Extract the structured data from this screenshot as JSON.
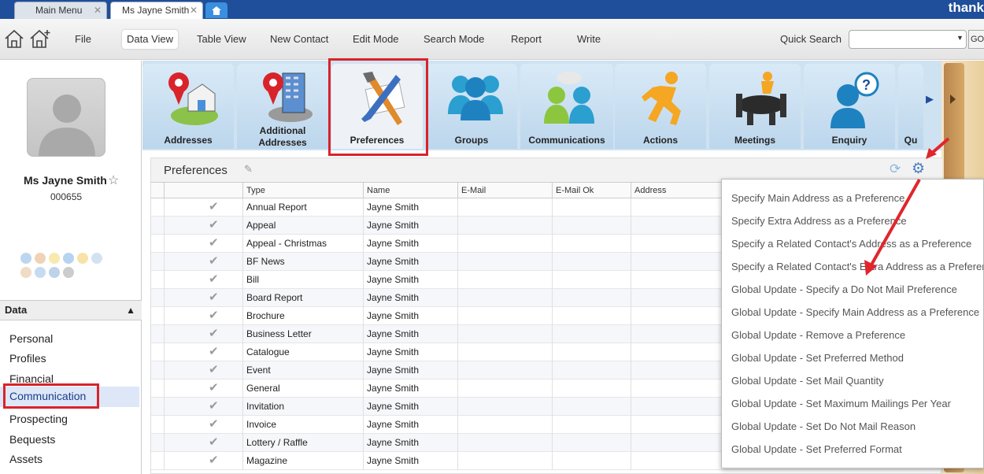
{
  "tabs": [
    {
      "label": "Main Menu"
    },
    {
      "label": "Ms Jayne Smith"
    }
  ],
  "brand": "thank",
  "menu": {
    "items": [
      "File",
      "Data View",
      "Table View",
      "New Contact",
      "Edit Mode",
      "Search Mode",
      "Report",
      "Write"
    ],
    "quick_search_label": "Quick Search",
    "go_label": "GO"
  },
  "contact": {
    "name": "Ms Jayne Smith",
    "id": "000655"
  },
  "left_nav": {
    "header": "Data",
    "items": [
      "Personal",
      "Profiles",
      "Financial",
      "Communication",
      "Prospecting",
      "Bequests",
      "Assets"
    ]
  },
  "modules": [
    {
      "label": "Addresses",
      "icon": "pin-house-icon"
    },
    {
      "label": "Additional Addresses",
      "icon": "pin-building-icon"
    },
    {
      "label": "Preferences",
      "icon": "tools-icon"
    },
    {
      "label": "Groups",
      "icon": "people-icon"
    },
    {
      "label": "Communications",
      "icon": "people-chat-icon"
    },
    {
      "label": "Actions",
      "icon": "running-man-icon"
    },
    {
      "label": "Meetings",
      "icon": "meeting-table-icon"
    },
    {
      "label": "Enquiry",
      "icon": "question-person-icon"
    },
    {
      "label": "Qu",
      "icon": "partial-icon"
    }
  ],
  "grid": {
    "title": "Preferences",
    "columns": [
      "Type",
      "Name",
      "E-Mail",
      "E-Mail Ok",
      "Address"
    ],
    "rows": [
      {
        "type": "Annual Report",
        "name": "Jayne Smith"
      },
      {
        "type": "Appeal",
        "name": "Jayne Smith"
      },
      {
        "type": "Appeal - Christmas",
        "name": "Jayne Smith"
      },
      {
        "type": "BF News",
        "name": "Jayne Smith"
      },
      {
        "type": "Bill",
        "name": "Jayne Smith"
      },
      {
        "type": "Board Report",
        "name": "Jayne Smith"
      },
      {
        "type": "Brochure",
        "name": "Jayne Smith"
      },
      {
        "type": "Business Letter",
        "name": "Jayne Smith"
      },
      {
        "type": "Catalogue",
        "name": "Jayne Smith"
      },
      {
        "type": "Event",
        "name": "Jayne Smith"
      },
      {
        "type": "General",
        "name": "Jayne Smith"
      },
      {
        "type": "Invitation",
        "name": "Jayne Smith"
      },
      {
        "type": "Invoice",
        "name": "Jayne Smith"
      },
      {
        "type": "Lottery / Raffle",
        "name": "Jayne Smith"
      },
      {
        "type": "Magazine",
        "name": "Jayne Smith"
      }
    ]
  },
  "dropdown": {
    "items": [
      "Specify Main Address as a Preference",
      "Specify Extra Address as a Preference",
      "Specify a Related Contact's Address as a Preference",
      "Specify a Related Contact's Extra Address as a Preference",
      "Global Update - Specify a Do Not Mail Preference",
      "Global Update - Specify Main Address as a Preference",
      "Global Update - Remove a Preference",
      "Global Update - Set Preferred Method",
      "Global Update - Set Mail Quantity",
      "Global Update - Set Maximum Mailings Per Year",
      "Global Update - Set Do Not Mail Reason",
      "Global Update - Set Preferred Format"
    ]
  },
  "colors": {
    "tabbar": "#1f4e9a",
    "highlight_red": "#d9232a",
    "selection_blue": "#dde7f7"
  }
}
